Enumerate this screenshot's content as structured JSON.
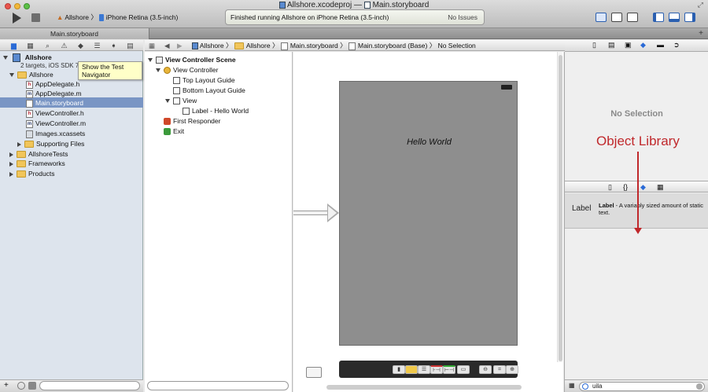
{
  "window": {
    "title_project": "Allshore.xcodeproj",
    "title_sep": "—",
    "title_file": "Main.storyboard"
  },
  "toolbar": {
    "scheme_target": "Allshore",
    "scheme_sep": "〉",
    "scheme_device": "iPhone Retina (3.5-inch)",
    "activity_status": "Finished running Allshore on iPhone Retina (3.5-inch)",
    "activity_issues": "No Issues"
  },
  "tab": {
    "label": "Main.storyboard",
    "add": "+"
  },
  "navigator": {
    "tooltip": "Show the Test Navigator",
    "project_name": "Allshore",
    "project_sub": "2 targets, iOS SDK 7.0",
    "items": [
      {
        "label": "Allshore",
        "kind": "folder"
      },
      {
        "label": "AppDelegate.h",
        "kind": "h"
      },
      {
        "label": "AppDelegate.m",
        "kind": "m"
      },
      {
        "label": "Main.storyboard",
        "kind": "sb"
      },
      {
        "label": "ViewController.h",
        "kind": "h"
      },
      {
        "label": "ViewController.m",
        "kind": "m"
      },
      {
        "label": "Images.xcassets",
        "kind": "xc"
      },
      {
        "label": "Supporting Files",
        "kind": "folder"
      },
      {
        "label": "AllshoreTests",
        "kind": "folder"
      },
      {
        "label": "Frameworks",
        "kind": "folder"
      },
      {
        "label": "Products",
        "kind": "folder"
      }
    ],
    "filter_plus": "+"
  },
  "jumpbar": {
    "crumbs": [
      "Allshore",
      "Allshore",
      "Main.storyboard",
      "Main.storyboard (Base)",
      "No Selection"
    ]
  },
  "outline": {
    "scene": "View Controller Scene",
    "vc": "View Controller",
    "top_guide": "Top Layout Guide",
    "bottom_guide": "Bottom Layout Guide",
    "view": "View",
    "label": "Label - Hello World",
    "first_responder": "First Responder",
    "exit": "Exit"
  },
  "canvas": {
    "hello": "Hello World"
  },
  "inspector": {
    "no_selection": "No Selection",
    "annotation": "Object Library",
    "lib_item_icon": "Label",
    "lib_item_title": "Label",
    "lib_item_desc": " - A variably sized amount of static text.",
    "search_value": "uila"
  },
  "colors": {
    "accent_selection": "#7995c4",
    "annotation": "#c0282b"
  }
}
